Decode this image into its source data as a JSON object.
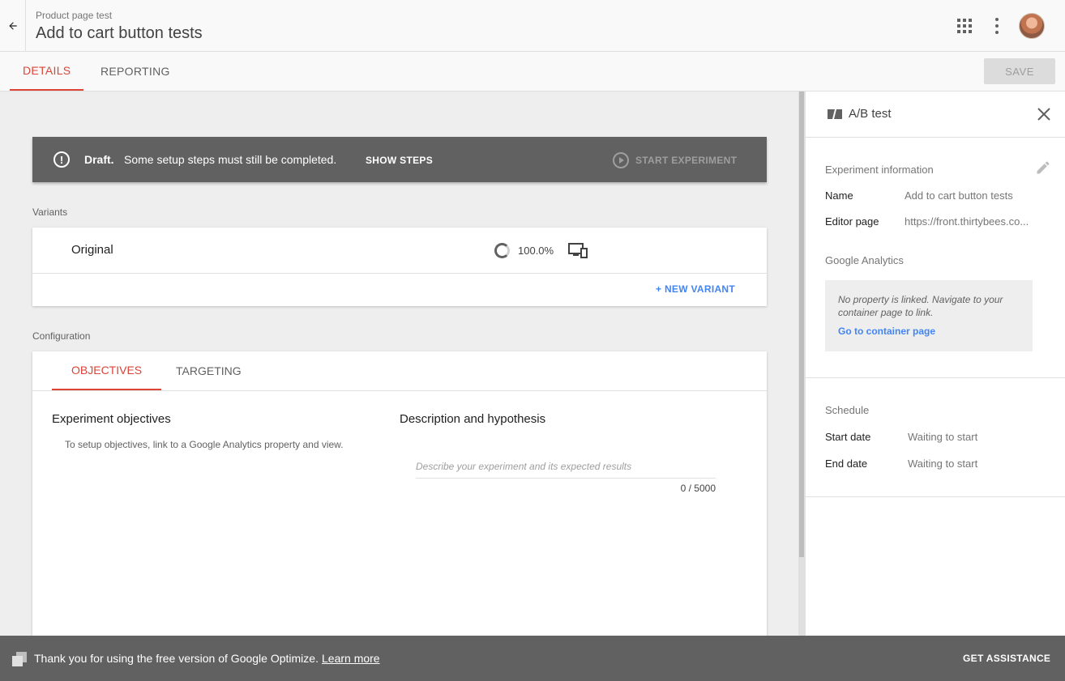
{
  "header": {
    "subtitle": "Product page test",
    "title": "Add to cart button tests"
  },
  "tabs": {
    "details": "DETAILS",
    "reporting": "REPORTING",
    "save": "SAVE"
  },
  "draft": {
    "label": "Draft.",
    "message": "Some setup steps must still be completed.",
    "show_steps": "SHOW STEPS",
    "start": "START EXPERIMENT",
    "icon_text": "!"
  },
  "variants": {
    "section_label": "Variants",
    "items": [
      {
        "name": "Original",
        "weight": "100.0%"
      }
    ],
    "new_variant": "+ NEW VARIANT"
  },
  "configuration": {
    "section_label": "Configuration",
    "tabs": [
      "OBJECTIVES",
      "TARGETING"
    ],
    "objectives_title": "Experiment objectives",
    "objectives_hint": "To setup objectives, link to a Google Analytics property and view.",
    "description_title": "Description and hypothesis",
    "description_placeholder": "Describe your experiment and its expected results",
    "description_count": "0 / 5000"
  },
  "panel": {
    "title": "A/B test",
    "experiment_info": {
      "heading": "Experiment information",
      "name_key": "Name",
      "name_value": "Add to cart button tests",
      "editor_key": "Editor page",
      "editor_value": "https://front.thirtybees.co..."
    },
    "google_analytics": {
      "heading": "Google Analytics",
      "note": "No property is linked. Navigate to your container page to link.",
      "link": "Go to container page"
    },
    "schedule": {
      "heading": "Schedule",
      "start_key": "Start date",
      "start_value": "Waiting to start",
      "end_key": "End date",
      "end_value": "Waiting to start"
    }
  },
  "footer": {
    "message": "Thank you for using the free version of Google Optimize.",
    "learn_more": "Learn more",
    "assistance": "GET ASSISTANCE"
  },
  "colors": {
    "accent_red": "#db4437",
    "link_blue": "#4285f4",
    "dark_bar": "#616161"
  }
}
